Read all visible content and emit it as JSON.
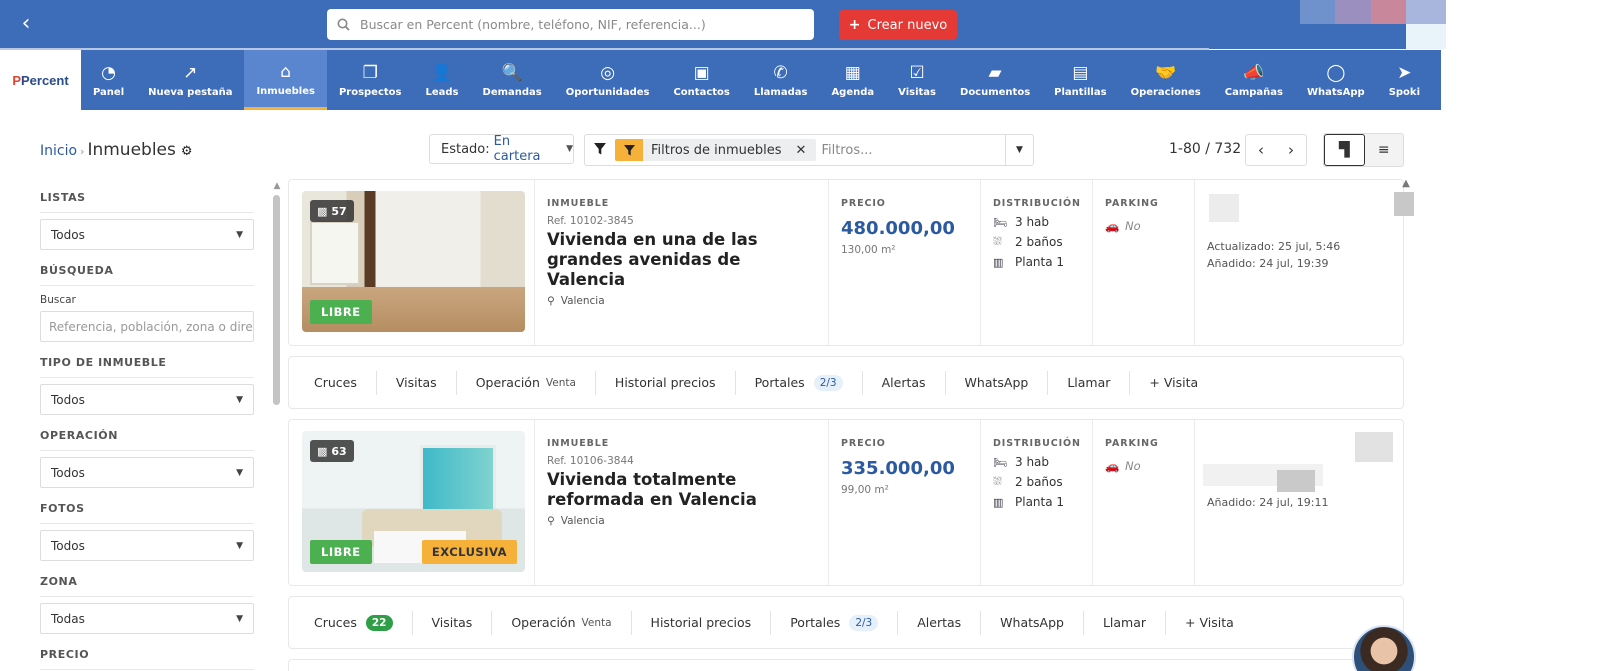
{
  "topbar": {
    "search_placeholder": "Buscar en Percent (nombre, teléfono, NIF, referencia...)",
    "create_label": "Crear nuevo"
  },
  "logo": {
    "text": "Percent"
  },
  "nav": [
    {
      "label": "Panel",
      "icon": "gauge-icon",
      "glyph": "◔"
    },
    {
      "label": "Nueva pestaña",
      "icon": "external-link-icon",
      "glyph": "↗"
    },
    {
      "label": "Inmuebles",
      "icon": "home-icon",
      "glyph": "⌂",
      "active": true
    },
    {
      "label": "Prospectos",
      "icon": "copy-icon",
      "glyph": "❐"
    },
    {
      "label": "Leads",
      "icon": "user-plus-icon",
      "glyph": "👤"
    },
    {
      "label": "Demandas",
      "icon": "search-plus-icon",
      "glyph": "🔍"
    },
    {
      "label": "Oportunidades",
      "icon": "target-icon",
      "glyph": "◎"
    },
    {
      "label": "Contactos",
      "icon": "contact-book-icon",
      "glyph": "▣"
    },
    {
      "label": "Llamadas",
      "icon": "phone-icon",
      "glyph": "✆"
    },
    {
      "label": "Agenda",
      "icon": "calendar-icon",
      "glyph": "▦"
    },
    {
      "label": "Visitas",
      "icon": "calendar-check-icon",
      "glyph": "☑"
    },
    {
      "label": "Documentos",
      "icon": "folder-icon",
      "glyph": "▰"
    },
    {
      "label": "Plantillas",
      "icon": "template-icon",
      "glyph": "▤"
    },
    {
      "label": "Operaciones",
      "icon": "handshake-icon",
      "glyph": "🤝"
    },
    {
      "label": "Campañas",
      "icon": "megaphone-icon",
      "glyph": "📣"
    },
    {
      "label": "WhatsApp",
      "icon": "whatsapp-icon",
      "glyph": "◯"
    },
    {
      "label": "Spoki",
      "icon": "paper-plane-icon",
      "glyph": "➤"
    }
  ],
  "breadcrumb": {
    "home": "Inicio",
    "current": "Inmuebles"
  },
  "sidebar": {
    "listas_label": "LISTAS",
    "listas_value": "Todos",
    "busqueda_label": "BÚSQUEDA",
    "buscar_label": "Buscar",
    "buscar_placeholder": "Referencia, población, zona o direcci",
    "tipo_label": "TIPO DE INMUEBLE",
    "tipo_value": "Todos",
    "operacion_label": "OPERACIÓN",
    "operacion_value": "Todos",
    "fotos_label": "FOTOS",
    "fotos_value": "Todos",
    "zona_label": "ZONA",
    "zona_value": "Todas",
    "precio_label": "PRECIO"
  },
  "toolbar": {
    "estado_label": "Estado:",
    "estado_value": "En cartera",
    "filter_chip": "Filtros de inmuebles",
    "filter_placeholder": "Filtros...",
    "pagination": "1-80 / 732"
  },
  "properties": [
    {
      "photo_count": "57",
      "status": "LIBRE",
      "exclusive": "",
      "section_label": "INMUEBLE",
      "ref": "Ref. 10102-3845",
      "title": "Vivienda en una de las grandes avenidas de Valencia",
      "location": "Valencia",
      "price_label": "PRECIO",
      "price": "480.000,00",
      "area": "130,00 m²",
      "dist_label": "DISTRIBUCIÓN",
      "rooms": "3 hab",
      "baths": "2 baños",
      "floor": "Planta 1",
      "parking_label": "PARKING",
      "parking": "No",
      "updated": "Actualizado: 25 jul, 5:46",
      "added": "Añadido: 24 jul, 19:39",
      "actions": {
        "cruces": "Cruces",
        "cruces_badge": "",
        "visitas": "Visitas",
        "operacion": "Operación",
        "operacion_value": "Venta",
        "historial": "Historial precios",
        "portales": "Portales",
        "portales_badge": "2/3",
        "alertas": "Alertas",
        "whatsapp": "WhatsApp",
        "llamar": "Llamar",
        "visita": "+ Visita"
      }
    },
    {
      "photo_count": "63",
      "status": "LIBRE",
      "exclusive": "EXCLUSIVA",
      "section_label": "INMUEBLE",
      "ref": "Ref. 10106-3844",
      "title": "Vivienda totalmente reformada en Valencia",
      "location": "Valencia",
      "price_label": "PRECIO",
      "price": "335.000,00",
      "area": "99,00 m²",
      "dist_label": "DISTRIBUCIÓN",
      "rooms": "3 hab",
      "baths": "2 baños",
      "floor": "Planta 1",
      "parking_label": "PARKING",
      "parking": "No",
      "updated": "",
      "added": "Añadido: 24 jul, 19:11",
      "actions": {
        "cruces": "Cruces",
        "cruces_badge": "22",
        "visitas": "Visitas",
        "operacion": "Operación",
        "operacion_value": "Venta",
        "historial": "Historial precios",
        "portales": "Portales",
        "portales_badge": "2/3",
        "alertas": "Alertas",
        "whatsapp": "WhatsApp",
        "llamar": "Llamar",
        "visita": "+ Visita"
      }
    }
  ],
  "colors": {
    "primary": "#3d6cb9",
    "accent": "#f6b13b",
    "danger": "#e53935",
    "success": "#4caf50"
  }
}
